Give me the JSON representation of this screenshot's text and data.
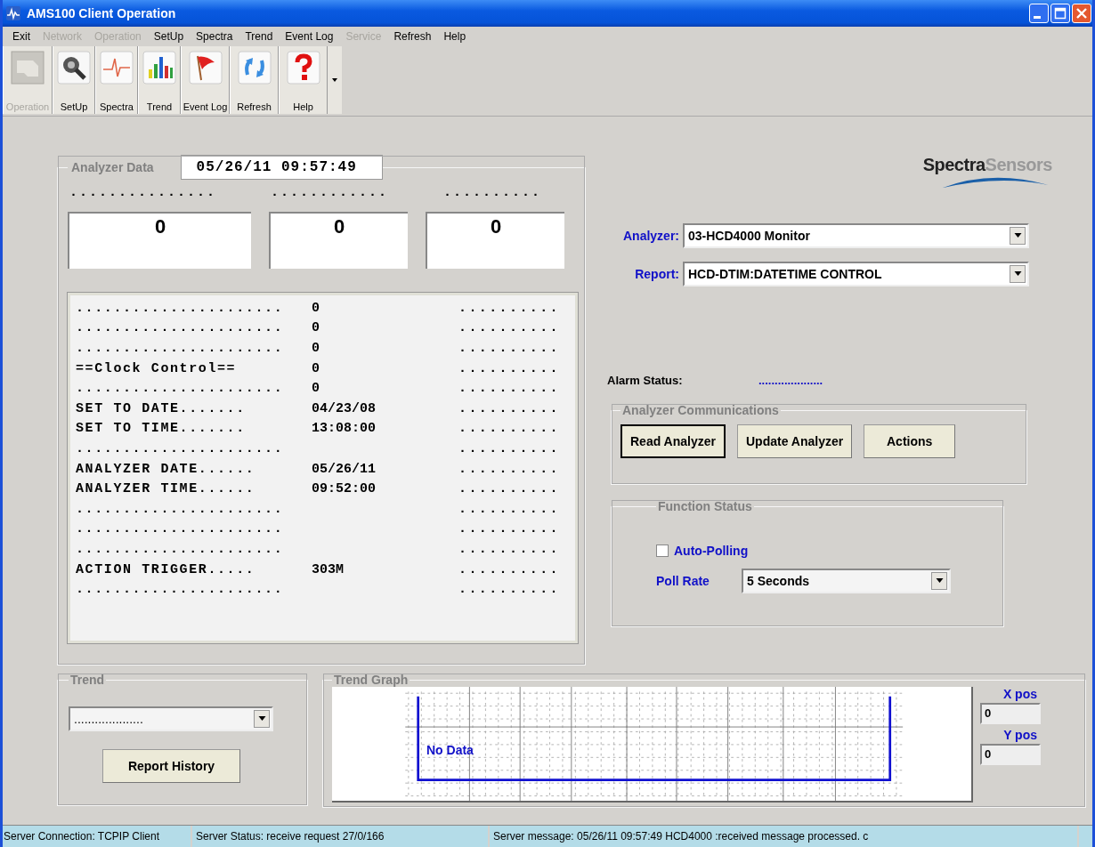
{
  "window": {
    "title": "AMS100 Client Operation"
  },
  "menu": [
    {
      "label": "Exit",
      "disabled": false
    },
    {
      "label": "Network",
      "disabled": true
    },
    {
      "label": "Operation",
      "disabled": true
    },
    {
      "label": "SetUp",
      "disabled": false
    },
    {
      "label": "Spectra",
      "disabled": false
    },
    {
      "label": "Trend",
      "disabled": false
    },
    {
      "label": "Event Log",
      "disabled": false
    },
    {
      "label": "Service",
      "disabled": true
    },
    {
      "label": "Refresh",
      "disabled": false
    },
    {
      "label": "Help",
      "disabled": false
    }
  ],
  "toolbar": [
    {
      "label": "Operation",
      "disabled": true
    },
    {
      "label": "SetUp",
      "disabled": false
    },
    {
      "label": "Spectra",
      "disabled": false
    },
    {
      "label": "Trend",
      "disabled": false
    },
    {
      "label": "Event Log",
      "disabled": false
    },
    {
      "label": "Refresh",
      "disabled": false
    },
    {
      "label": "Help",
      "disabled": false
    }
  ],
  "analyzer_data": {
    "title": "Analyzer Data",
    "timestamp": "05/26/11 09:57:49",
    "channels": [
      {
        "label": "...............",
        "value": "0"
      },
      {
        "label": "............",
        "value": "0"
      },
      {
        "label": "..........",
        "value": "0"
      }
    ],
    "lines": [
      {
        "label": "......................",
        "value": "0",
        "right": ".........."
      },
      {
        "label": "......................",
        "value": "0",
        "right": ".........."
      },
      {
        "label": "......................",
        "value": "0",
        "right": ".........."
      },
      {
        "label": "==Clock Control==",
        "value": "0",
        "right": ".........."
      },
      {
        "label": "......................",
        "value": "0",
        "right": ".........."
      },
      {
        "label": "SET TO DATE.......",
        "value": "04/23/08",
        "right": ".........."
      },
      {
        "label": "SET TO TIME.......",
        "value": "13:08:00",
        "right": ".........."
      },
      {
        "label": "......................",
        "right": ".........."
      },
      {
        "label": "ANALYZER DATE......",
        "value": "05/26/11",
        "right": ".........."
      },
      {
        "label": "ANALYZER TIME......",
        "value": "09:52:00",
        "right": ".........."
      },
      {
        "label": "......................",
        "right": ".........."
      },
      {
        "label": "......................",
        "right": ".........."
      },
      {
        "label": "......................",
        "right": ".........."
      },
      {
        "label": "ACTION TRIGGER.....",
        "value": "303M",
        "right": ".........."
      },
      {
        "label": "......................",
        "right": ".........."
      }
    ]
  },
  "logo": "**Spectra**Sensors",
  "analyzer": {
    "label": "Analyzer:",
    "value": "03-HCD4000 Monitor"
  },
  "report": {
    "label": "Report:",
    "value": "HCD-DTIM:DATETIME CONTROL"
  },
  "alarm": {
    "label": "Alarm Status:",
    "value": "...................."
  },
  "communications": {
    "title": "Analyzer Communications",
    "buttons": [
      {
        "label": "Read Analyzer",
        "default": true
      },
      {
        "label": "Update Analyzer",
        "default": false
      },
      {
        "label": "Actions",
        "default": false
      }
    ]
  },
  "function_status": {
    "title": "Function Status",
    "auto_polling": {
      "label": "Auto-Polling",
      "checked": false
    },
    "poll_rate": {
      "label": "Poll Rate",
      "value": "5 Seconds"
    }
  },
  "trend": {
    "title": "Trend",
    "select_value": "....................",
    "button": "Report History"
  },
  "trend_graph": {
    "title": "Trend Graph",
    "message": "No Data",
    "x_label": "X pos",
    "x_value": "0",
    "y_label": "Y pos",
    "y_value": "0"
  },
  "status_bar": [
    "Server Connection: TCPIP Client",
    "Server Status: receive request 27/0/166",
    "Server message: 05/26/11 09:57:49 HCD4000 :received message processed.  c"
  ]
}
